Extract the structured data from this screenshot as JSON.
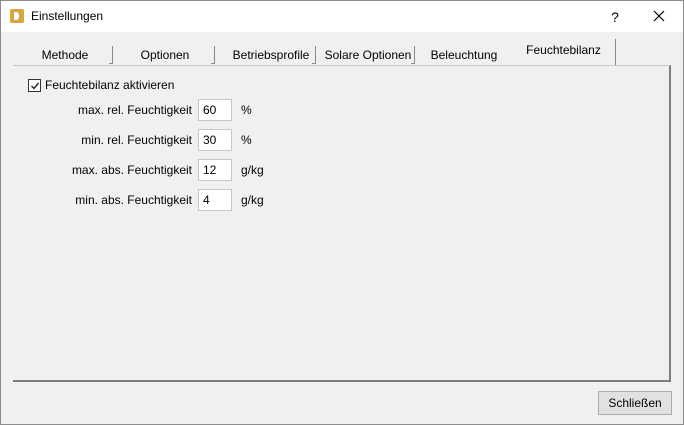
{
  "window": {
    "title": "Einstellungen",
    "help_label": "?"
  },
  "tabs": [
    {
      "label": "Methode",
      "active": false
    },
    {
      "label": "Optionen",
      "active": false
    },
    {
      "label": "Betriebsprofile",
      "active": false
    },
    {
      "label": "Solare Optionen",
      "active": false
    },
    {
      "label": "Beleuchtung",
      "active": false
    },
    {
      "label": "Feuchtebilanz",
      "active": true
    }
  ],
  "panel": {
    "enable_checkbox": {
      "label": "Feuchtebilanz aktivieren",
      "checked": true
    },
    "fields": [
      {
        "label": "max. rel. Feuchtigkeit",
        "value": "60",
        "unit": "%"
      },
      {
        "label": "min. rel. Feuchtigkeit",
        "value": "30",
        "unit": "%"
      },
      {
        "label": "max. abs. Feuchtigkeit",
        "value": "12",
        "unit": "g/kg"
      },
      {
        "label": "min. abs. Feuchtigkeit",
        "value": "4",
        "unit": "g/kg"
      }
    ]
  },
  "footer": {
    "close_label": "Schließen"
  },
  "colors": {
    "app_icon": "#d9a441",
    "window_bg": "#f0f0f0",
    "button_bg": "#e1e1e1"
  }
}
